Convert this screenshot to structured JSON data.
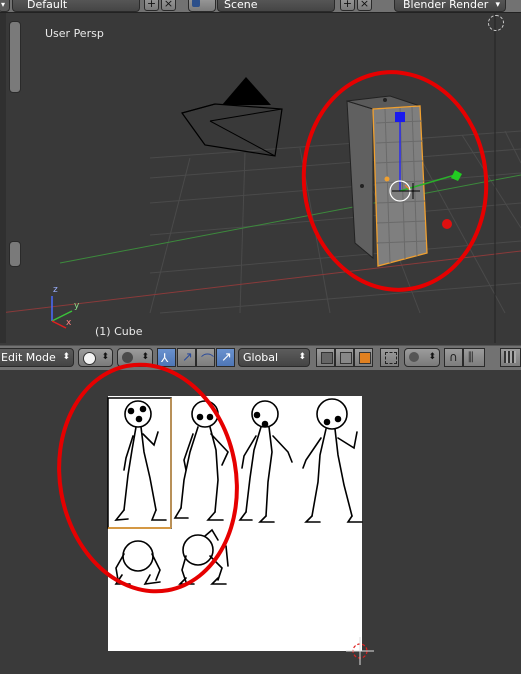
{
  "header": {
    "layout_name": "Default",
    "scene_name": "Scene",
    "render_engine": "Blender Render"
  },
  "viewport": {
    "view_label": "User Persp",
    "object_label": "(1) Cube",
    "axis_labels": {
      "x": "x",
      "y": "y",
      "z": "z"
    }
  },
  "toolbar": {
    "mode": "Edit Mode",
    "orientation": "Global"
  },
  "colors": {
    "annotation": "#e60000",
    "selection": "#f0a030",
    "active_button": "#5a82c2"
  }
}
